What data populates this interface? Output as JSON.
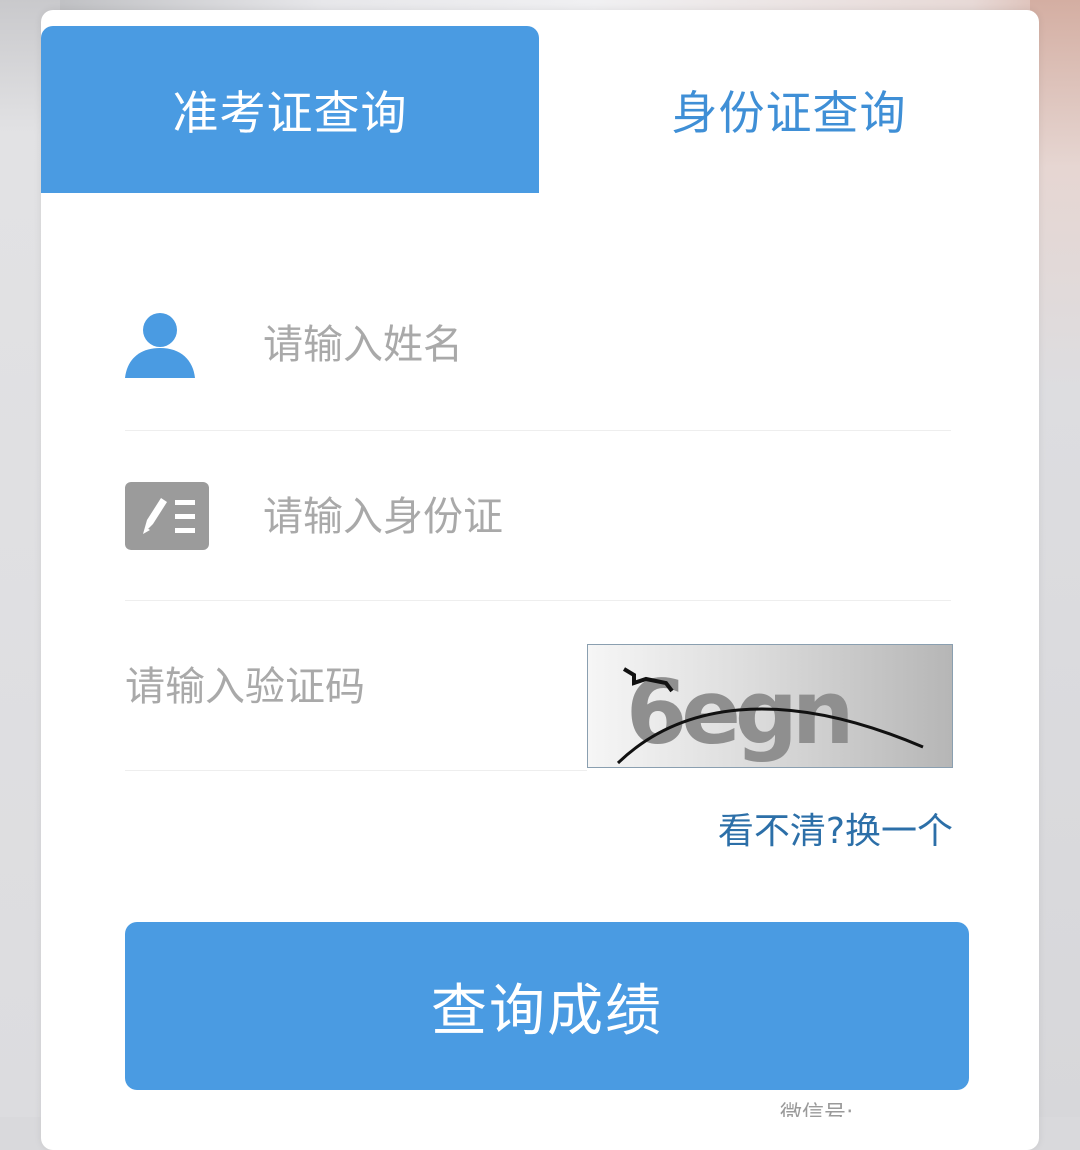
{
  "tabs": {
    "admission_ticket": "准考证查询",
    "id_card": "身份证查询"
  },
  "form": {
    "name_placeholder": "请输入姓名",
    "id_placeholder": "请输入身份证",
    "captcha_placeholder": "请输入验证码",
    "captcha_text": "6egn",
    "refresh_label": "看不清?换一个",
    "submit_label": "查询成绩"
  },
  "icons": {
    "name": "user-icon",
    "id": "id-card-icon"
  },
  "colors": {
    "accent": "#4a9be2",
    "tab_text": "#3f8fd6",
    "link": "#2c6fa8",
    "placeholder": "#a9a9a9",
    "icon_gray": "#9b9b9b"
  },
  "watermark": "微信号: …"
}
